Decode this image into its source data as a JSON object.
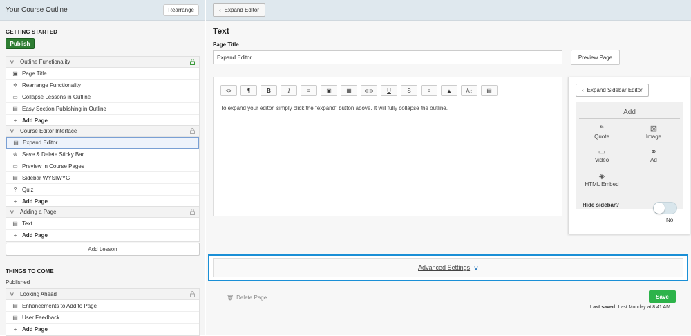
{
  "sidebar": {
    "title": "Your Course Outline",
    "rearrange_label": "Rearrange",
    "section1": {
      "title": "GETTING STARTED",
      "publish_label": "Publish"
    },
    "lessons": [
      {
        "title": "Outline Functionality",
        "items": [
          "Page Title",
          "Rearrange Functionality",
          "Collapse Lessons in Outline",
          "Easy Section Publishing in Outline"
        ],
        "add": "Add Page"
      },
      {
        "title": "Course Editor Interface",
        "items": [
          "Expand Editor",
          "Save & Delete Sticky Bar",
          "Preview in Course Pages",
          "Sidebar WYSIWYG",
          "Quiz"
        ],
        "add": "Add Page"
      },
      {
        "title": "Adding a Page",
        "items": [
          "Text"
        ],
        "add": "Add Page"
      }
    ],
    "add_lesson_label": "Add Lesson",
    "section2": {
      "title": "THINGS TO COME",
      "status": "Published"
    },
    "lessons2": [
      {
        "title": "Looking Ahead",
        "items": [
          "Enhancements to Add to Page",
          "User Feedback"
        ],
        "add": "Add Page"
      }
    ]
  },
  "topbar": {
    "expand_label": "Expand Editor"
  },
  "main": {
    "heading": "Text",
    "page_title_label": "Page Title",
    "page_title_value": "Expand Editor",
    "preview_label": "Preview Page",
    "editor_body": "To expand your editor, simply click the \"expand\" button above. It will fully collapse the outline.",
    "toolbar_glyphs": [
      "<>",
      "¶",
      "B",
      "I",
      "≡",
      "▣",
      "▦",
      "⊂⊃",
      "U",
      "S",
      "≡",
      "▲",
      "A↕",
      "▤"
    ]
  },
  "sidepanel": {
    "expand_label": "Expand Sidebar Editor",
    "add_title": "Add",
    "blocks": {
      "quote": "Quote",
      "image": "Image",
      "video": "Video",
      "ad": "Ad",
      "html": "HTML Embed"
    },
    "hide_label": "Hide sidebar?",
    "toggle_value": "No"
  },
  "advanced_label": "Advanced Settings",
  "delete_label": "Delete Page",
  "save_label": "Save",
  "last_saved_label": "Last saved:",
  "last_saved_value": "Last Monday at 8:41 AM",
  "colors": {
    "accent": "#1a8fd6",
    "publish": "#2e7d32",
    "save": "#2db34a",
    "header": "#dfe8ee"
  }
}
